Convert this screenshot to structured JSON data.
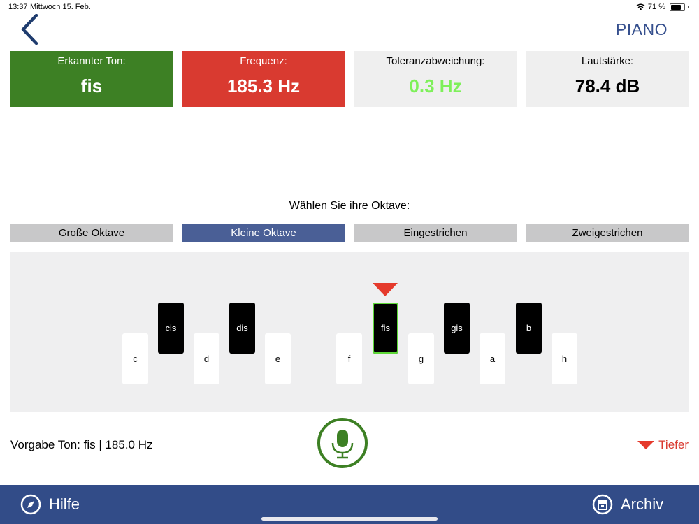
{
  "status": {
    "time": "13:37",
    "date": "Mittwoch 15. Feb.",
    "battery": "71 %",
    "battery_level": 0.71
  },
  "header": {
    "back_icon": "chevron-left-icon",
    "title": "PIANO"
  },
  "cards": {
    "tone": {
      "label": "Erkannter Ton:",
      "value": "fis",
      "color": "#3d8024"
    },
    "frequency": {
      "label": "Frequenz:",
      "value": "185.3 Hz",
      "color": "#d93a30"
    },
    "tolerance": {
      "label": "Toleranzabweichung:",
      "value": "0.3 Hz",
      "value_color": "#7ef05a"
    },
    "volume": {
      "label": "Lautstärke:",
      "value": "78.4 dB"
    }
  },
  "octave": {
    "prompt": "Wählen Sie ihre Oktave:",
    "options": [
      "Große Oktave",
      "Kleine Oktave",
      "Eingestrichen",
      "Zweigestrichen"
    ],
    "selected": "Kleine Oktave"
  },
  "keys": {
    "white": [
      "c",
      "d",
      "e",
      "f",
      "g",
      "a",
      "h"
    ],
    "black": [
      "cis",
      "dis",
      "fis",
      "gis",
      "b"
    ],
    "selected": "fis"
  },
  "bottom": {
    "target": "Vorgabe Ton: fis | 185.0 Hz",
    "mic_icon": "microphone-icon",
    "direction": "Tiefer",
    "direction_color": "#d93a30"
  },
  "footer": {
    "help": {
      "label": "Hilfe",
      "icon": "compass-icon"
    },
    "archive": {
      "label": "Archiv",
      "icon": "archive-box-icon"
    }
  }
}
